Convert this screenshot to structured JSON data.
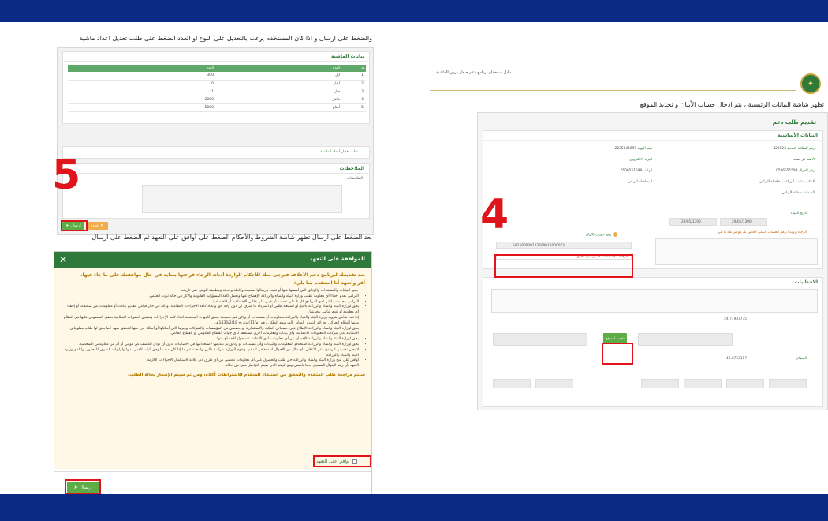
{
  "left": {
    "caption_top": "والضغط على ارسال و اذا كان المستخدم يرغب بالتعديل على النوع او العدد الضغط على طلب تعديل اعداد ماشية",
    "livestock_title": "بيانات الماشية",
    "livestock_headers": [
      "م",
      "النوع",
      "العدد"
    ],
    "livestock_rows": [
      [
        "1",
        "ابل",
        "300"
      ],
      [
        "2",
        "أبقار",
        "0"
      ],
      [
        "3",
        "خيل",
        "1"
      ],
      [
        "4",
        "ماعز",
        "2000"
      ],
      [
        "5",
        "أغنام",
        "5000"
      ]
    ],
    "modify_link": "طلب تعديل أعداد الماشية",
    "notes_title": "الملاحظات",
    "notes_label": "الملاحظات",
    "send_label": "إرسال",
    "back_label": "عودة",
    "step5": "5",
    "caption_mid": "بعد الضغط على ارسال تظهر شاشة الشروط والأحكام الضغط على أوافق على التعهد ثم الضغط على ارسال",
    "modal": {
      "title": "الموافقة على التعهد",
      "intro": "بعد تقديمك لبرنامج دعم الأعلاف فيرجى منك للأحكام الواردة أدناه، الرجاء قراءتها بعناية في حال موافقتك على ما جاء فيها.",
      "sub": "أقر وأتعهد أنا المتقدم بما يلي:",
      "items": [
        "جميع البيانات والمستندات والوثائق التي أضفتها عنها أو قمت بإرسالها صحيحة وكاملة وحديثة ومطابقة للواقع حتى تاريخه.",
        "التزامي بعدم إخفاء أي معلومة تطلب وزارة البيئة والمياه والزراعة الإفصاح عنها وتحمل كافة المسؤولية القانونية والآثار في حالة ثبوت العكس.",
        "التزامي بتحديث بياناتي لدى البرنامج كل ما طرأ تحديث أو تغيير على حالتي الاجتماعية أو الاقتصادية.",
        "يحق لوزارة البيئة والمياه والزراعة تأجيل أو استبعاد طلبي أو استرداد ما صرف لي دون وجه حق واتخاذ كافة الإجراءات النظامية، وذلك في حال قيامي بتقديم بيانات أو معلومات غير صحيحة، أو إخفاء أي معلومة أو عدم قيامي بتحديثها.",
        "إذا ثبت قيامي بتزويد وزارة البيئة والمياه والزراعة بمعلومات أو مستندات أو وثائق غير صحيحة فيحق للجهات المختصة اتخاذ كافة الإجراءات وتطبيق العقوبات النظامية بحقي المنصوص عليها في النظام ومنها النظام الجزائي لجرائم التزوير الصادر بالمرسوم الملكي رقم (م/11) وتاريخ 1435/2/18هـ.",
        "يحق لوزارة البيئة والمياه والزراعة الاطلاع على حساباتي البنكية والاستثمارية أو حصصي في المؤسسات والشركات وغيرها التي أمتلكها أو أمتلك جزء منها للتحقق منها، كما يحق لها طلب معلوماتي الائتمانية لدى شركات المعلومات الائتمانية، وأي بيانات ومعلومات أخرى مستحقة لدى جهات القطاع الحكومي أو القطاع الخاص.",
        "يحق لوزارة البيئة والمياه والزراعة الإفصاح عن أي معلومات لدى الأنظمة عند جواز الإفصاح عنها.",
        "يحق لوزارة البيئة والمياه والزراعة استخدام المعلومات والبيانات وأي مستندات أو وثائق تم تقديمها لاستخدامها في إحصائيات بدون أن تؤدي للكشف عن هويتي أو أي من معلوماتي الشخصية.",
        "لا يعني تقديمي لبرنامج دعم الأعلاف بأي حال من الأحوال استحقاقي للدعم، وتقوم الوزارة بدراسة طلبي والبحث عن ما إذا كان مناسباً وفق آليات العمل لديها وأولويات الصرف المعمول بها لدى وزارة البيئة والمياه والزراعة.",
        "أوافق على منح وزارة البيئة والمياه والزراعة حق طلب والحصول على أي معلومات تخصني من أي طرف ذي علاقة لاستكمال الإجراءات اللازمة.",
        "التعهد بأن رقم الجوال المسجل لدينا باسمي وهو الرقم الذي سيتم التواصل معي من خلاله."
      ],
      "footer_note": "سيتم مراجعة طلب المتقدم والتحقق من استيفاء المتقدم للاشتراطات أعلاه، ومن ثم سيتم الإشعار بحالة الطلب.",
      "agree_label": "أوافق على التعهد",
      "send_label": "إرسال"
    }
  },
  "right": {
    "doc_title": "دليل استخدام برنامج دعم صغار مربي الماشية",
    "description": "تظهر شاشة البيانات الرئيسية ، يتم ادخال حساب الأيبان و تحديد الموقع",
    "form_title": "تقديم طلب دعم",
    "basic_title": "البيانات الأساسية",
    "fields": [
      {
        "label": "رقم البطاقة المدنية",
        "value": "322623"
      },
      {
        "label": "رقم الهوية",
        "value": "2235045699"
      },
      {
        "label": "الاسم",
        "value": "عز أسعد"
      },
      {
        "label": "البريد الالكتروني",
        "value": ""
      },
      {
        "label": "رقم الجوال",
        "value": "0506551589"
      },
      {
        "label": "الهاتف",
        "value": "0506551589"
      },
      {
        "label": "المكتب",
        "value": "مكتب الزراعة بمحافظة الرياض"
      },
      {
        "label": "المحافظة",
        "value": "الرياض"
      },
      {
        "label": "المنطقة",
        "value": "منطقة الرياض"
      }
    ],
    "date_label": "تاريخ الميلاد",
    "date_value": "29/01/1390",
    "date_value2": "29/01/1390",
    "iban_notice": "الرجاء تزويدنا برقم الحساب البنكي الخاص بك مع مراعاة ما يلي:",
    "iban_label": "رقم حساب الآيبان",
    "iban_value": "SA1580000123608012000073",
    "iban_note": "الرجاء كتابة حساب الآيبان مرة أخرى",
    "step4": "4",
    "coords_title": "الاحداثيات",
    "location_button": "تحديد الموقع",
    "pen_label": "الحظائر",
    "coord_readout_a": "24.71947735",
    "coord_readout_b": "46.6753117"
  }
}
